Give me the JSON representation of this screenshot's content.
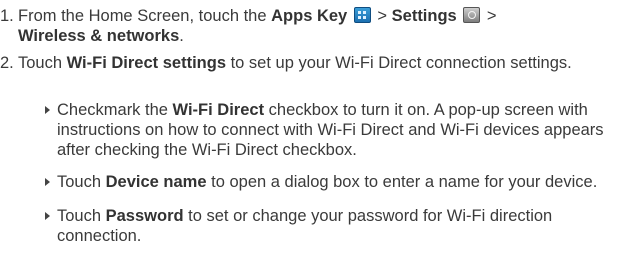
{
  "step1": {
    "number": "1.",
    "t1": "From the Home Screen, touch the ",
    "apps_key": "Apps Key",
    "sep1": " > ",
    "settings": "Settings",
    "sep2": " > ",
    "wireless": "Wireless & networks",
    "end": "."
  },
  "step2": {
    "number": "2.",
    "t1": "Touch ",
    "wfd_settings": "Wi-Fi Direct settings",
    "t2": " to set up your Wi-Fi Direct connection settings."
  },
  "bullets": [
    {
      "t1": "Checkmark the ",
      "bold": "Wi-Fi Direct",
      "t2": " checkbox to turn it on. A pop-up screen with instructions on how to connect with Wi-Fi Direct and Wi-Fi devices appears after checking the Wi-Fi Direct checkbox."
    },
    {
      "t1": "Touch ",
      "bold": "Device name",
      "t2": " to open a dialog box to enter a name for your device."
    },
    {
      "t1": "Touch ",
      "bold": "Password",
      "t2": " to set or change your password for Wi-Fi direction connection."
    }
  ],
  "icons": {
    "apps": "apps-key-icon",
    "settings": "settings-icon"
  }
}
